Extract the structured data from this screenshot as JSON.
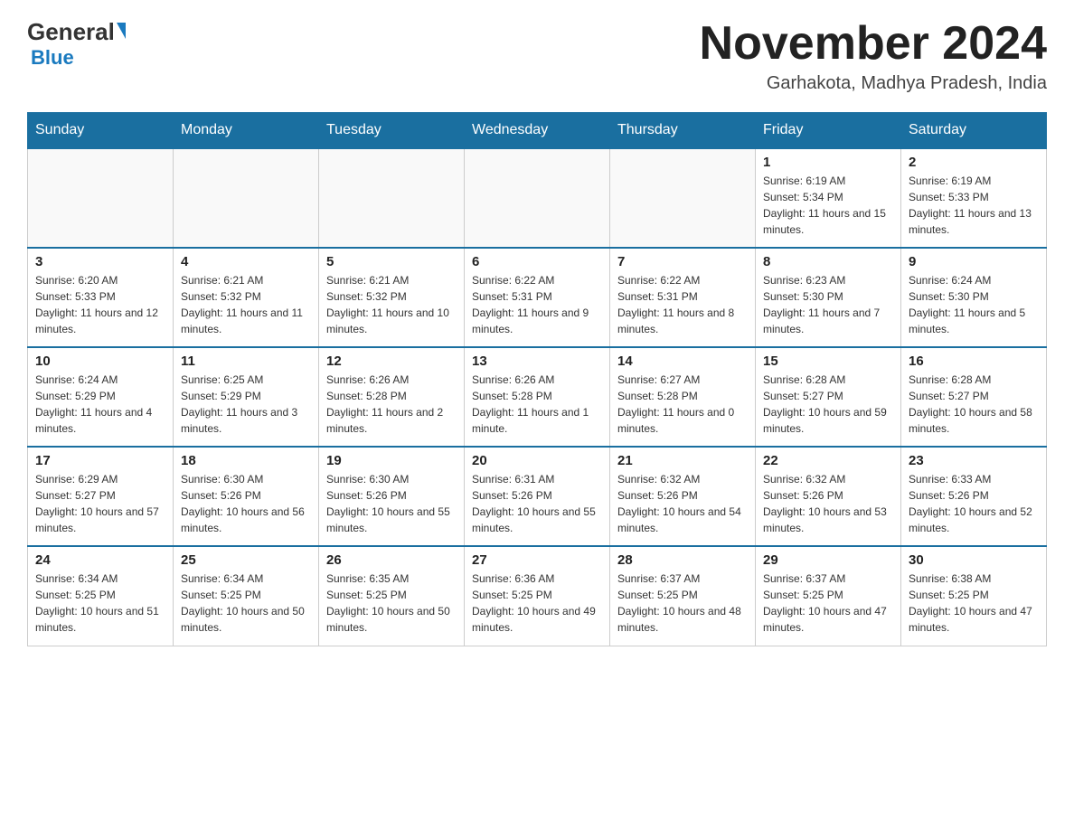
{
  "header": {
    "logo_main": "General",
    "logo_blue": "Blue",
    "month_title": "November 2024",
    "location": "Garhakota, Madhya Pradesh, India"
  },
  "days_of_week": [
    "Sunday",
    "Monday",
    "Tuesday",
    "Wednesday",
    "Thursday",
    "Friday",
    "Saturday"
  ],
  "weeks": [
    [
      {
        "day": "",
        "info": ""
      },
      {
        "day": "",
        "info": ""
      },
      {
        "day": "",
        "info": ""
      },
      {
        "day": "",
        "info": ""
      },
      {
        "day": "",
        "info": ""
      },
      {
        "day": "1",
        "info": "Sunrise: 6:19 AM\nSunset: 5:34 PM\nDaylight: 11 hours and 15 minutes."
      },
      {
        "day": "2",
        "info": "Sunrise: 6:19 AM\nSunset: 5:33 PM\nDaylight: 11 hours and 13 minutes."
      }
    ],
    [
      {
        "day": "3",
        "info": "Sunrise: 6:20 AM\nSunset: 5:33 PM\nDaylight: 11 hours and 12 minutes."
      },
      {
        "day": "4",
        "info": "Sunrise: 6:21 AM\nSunset: 5:32 PM\nDaylight: 11 hours and 11 minutes."
      },
      {
        "day": "5",
        "info": "Sunrise: 6:21 AM\nSunset: 5:32 PM\nDaylight: 11 hours and 10 minutes."
      },
      {
        "day": "6",
        "info": "Sunrise: 6:22 AM\nSunset: 5:31 PM\nDaylight: 11 hours and 9 minutes."
      },
      {
        "day": "7",
        "info": "Sunrise: 6:22 AM\nSunset: 5:31 PM\nDaylight: 11 hours and 8 minutes."
      },
      {
        "day": "8",
        "info": "Sunrise: 6:23 AM\nSunset: 5:30 PM\nDaylight: 11 hours and 7 minutes."
      },
      {
        "day": "9",
        "info": "Sunrise: 6:24 AM\nSunset: 5:30 PM\nDaylight: 11 hours and 5 minutes."
      }
    ],
    [
      {
        "day": "10",
        "info": "Sunrise: 6:24 AM\nSunset: 5:29 PM\nDaylight: 11 hours and 4 minutes."
      },
      {
        "day": "11",
        "info": "Sunrise: 6:25 AM\nSunset: 5:29 PM\nDaylight: 11 hours and 3 minutes."
      },
      {
        "day": "12",
        "info": "Sunrise: 6:26 AM\nSunset: 5:28 PM\nDaylight: 11 hours and 2 minutes."
      },
      {
        "day": "13",
        "info": "Sunrise: 6:26 AM\nSunset: 5:28 PM\nDaylight: 11 hours and 1 minute."
      },
      {
        "day": "14",
        "info": "Sunrise: 6:27 AM\nSunset: 5:28 PM\nDaylight: 11 hours and 0 minutes."
      },
      {
        "day": "15",
        "info": "Sunrise: 6:28 AM\nSunset: 5:27 PM\nDaylight: 10 hours and 59 minutes."
      },
      {
        "day": "16",
        "info": "Sunrise: 6:28 AM\nSunset: 5:27 PM\nDaylight: 10 hours and 58 minutes."
      }
    ],
    [
      {
        "day": "17",
        "info": "Sunrise: 6:29 AM\nSunset: 5:27 PM\nDaylight: 10 hours and 57 minutes."
      },
      {
        "day": "18",
        "info": "Sunrise: 6:30 AM\nSunset: 5:26 PM\nDaylight: 10 hours and 56 minutes."
      },
      {
        "day": "19",
        "info": "Sunrise: 6:30 AM\nSunset: 5:26 PM\nDaylight: 10 hours and 55 minutes."
      },
      {
        "day": "20",
        "info": "Sunrise: 6:31 AM\nSunset: 5:26 PM\nDaylight: 10 hours and 55 minutes."
      },
      {
        "day": "21",
        "info": "Sunrise: 6:32 AM\nSunset: 5:26 PM\nDaylight: 10 hours and 54 minutes."
      },
      {
        "day": "22",
        "info": "Sunrise: 6:32 AM\nSunset: 5:26 PM\nDaylight: 10 hours and 53 minutes."
      },
      {
        "day": "23",
        "info": "Sunrise: 6:33 AM\nSunset: 5:26 PM\nDaylight: 10 hours and 52 minutes."
      }
    ],
    [
      {
        "day": "24",
        "info": "Sunrise: 6:34 AM\nSunset: 5:25 PM\nDaylight: 10 hours and 51 minutes."
      },
      {
        "day": "25",
        "info": "Sunrise: 6:34 AM\nSunset: 5:25 PM\nDaylight: 10 hours and 50 minutes."
      },
      {
        "day": "26",
        "info": "Sunrise: 6:35 AM\nSunset: 5:25 PM\nDaylight: 10 hours and 50 minutes."
      },
      {
        "day": "27",
        "info": "Sunrise: 6:36 AM\nSunset: 5:25 PM\nDaylight: 10 hours and 49 minutes."
      },
      {
        "day": "28",
        "info": "Sunrise: 6:37 AM\nSunset: 5:25 PM\nDaylight: 10 hours and 48 minutes."
      },
      {
        "day": "29",
        "info": "Sunrise: 6:37 AM\nSunset: 5:25 PM\nDaylight: 10 hours and 47 minutes."
      },
      {
        "day": "30",
        "info": "Sunrise: 6:38 AM\nSunset: 5:25 PM\nDaylight: 10 hours and 47 minutes."
      }
    ]
  ]
}
